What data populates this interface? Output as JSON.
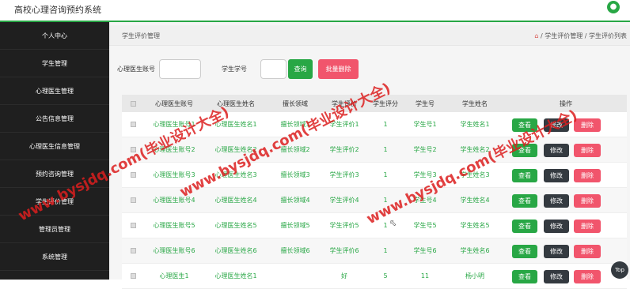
{
  "app": {
    "title": "高校心理咨询预约系统"
  },
  "sidebar": {
    "items": [
      {
        "label": "个人中心"
      },
      {
        "label": "学生管理"
      },
      {
        "label": "心理医生管理"
      },
      {
        "label": "公告信息管理"
      },
      {
        "label": "心理医生信息管理"
      },
      {
        "label": "预约咨询管理"
      },
      {
        "label": "学生评价管理"
      },
      {
        "label": "管理员管理"
      },
      {
        "label": "系统管理"
      }
    ]
  },
  "header": {
    "page_title": "学生评价管理",
    "breadcrumb": "/ 学生评价管理 / 学生评价列表"
  },
  "search": {
    "doctor_account_label": "心理医生账号",
    "student_id_label": "学生学号",
    "query_button": "查询",
    "batch_delete_button": "批量删除"
  },
  "table": {
    "columns": [
      "心理医生账号",
      "心理医生姓名",
      "擅长领域",
      "学生评价",
      "学生评分",
      "学生号",
      "学生姓名",
      "操作"
    ],
    "rows": [
      [
        "心理医生账号1",
        "心理医生姓名1",
        "擅长领域1",
        "学生评价1",
        "1",
        "学生号1",
        "学生姓名1"
      ],
      [
        "心理医生账号2",
        "心理医生姓名2",
        "擅长领域2",
        "学生评价2",
        "1",
        "学生号2",
        "学生姓名2"
      ],
      [
        "心理医生账号3",
        "心理医生姓名3",
        "擅长领域3",
        "学生评价3",
        "1",
        "学生号3",
        "学生姓名3"
      ],
      [
        "心理医生账号4",
        "心理医生姓名4",
        "擅长领域4",
        "学生评价4",
        "1",
        "学生号4",
        "学生姓名4"
      ],
      [
        "心理医生账号5",
        "心理医生姓名5",
        "擅长领域5",
        "学生评价5",
        "1",
        "学生号5",
        "学生姓名5"
      ],
      [
        "心理医生账号6",
        "心理医生姓名6",
        "擅长领域6",
        "学生评价6",
        "1",
        "学生号6",
        "学生姓名6"
      ],
      [
        "心理医生1",
        "心理医生姓名1",
        "",
        "好",
        "5",
        "11",
        "杨小明"
      ]
    ],
    "view_label": "查看",
    "edit_label": "修改",
    "delete_label": "删除"
  },
  "scroll_top_label": "Top",
  "watermarks": [
    "www.bysjdq.com(毕业设计大全)",
    "www.bysjdq.com(毕业设计大全)",
    "www.bysjdq.com(毕业设计大全)"
  ],
  "colors": {
    "accent": "#28a745",
    "danger": "#f1556c",
    "dark": "#343a40",
    "sidebar": "#1f1f1f"
  }
}
